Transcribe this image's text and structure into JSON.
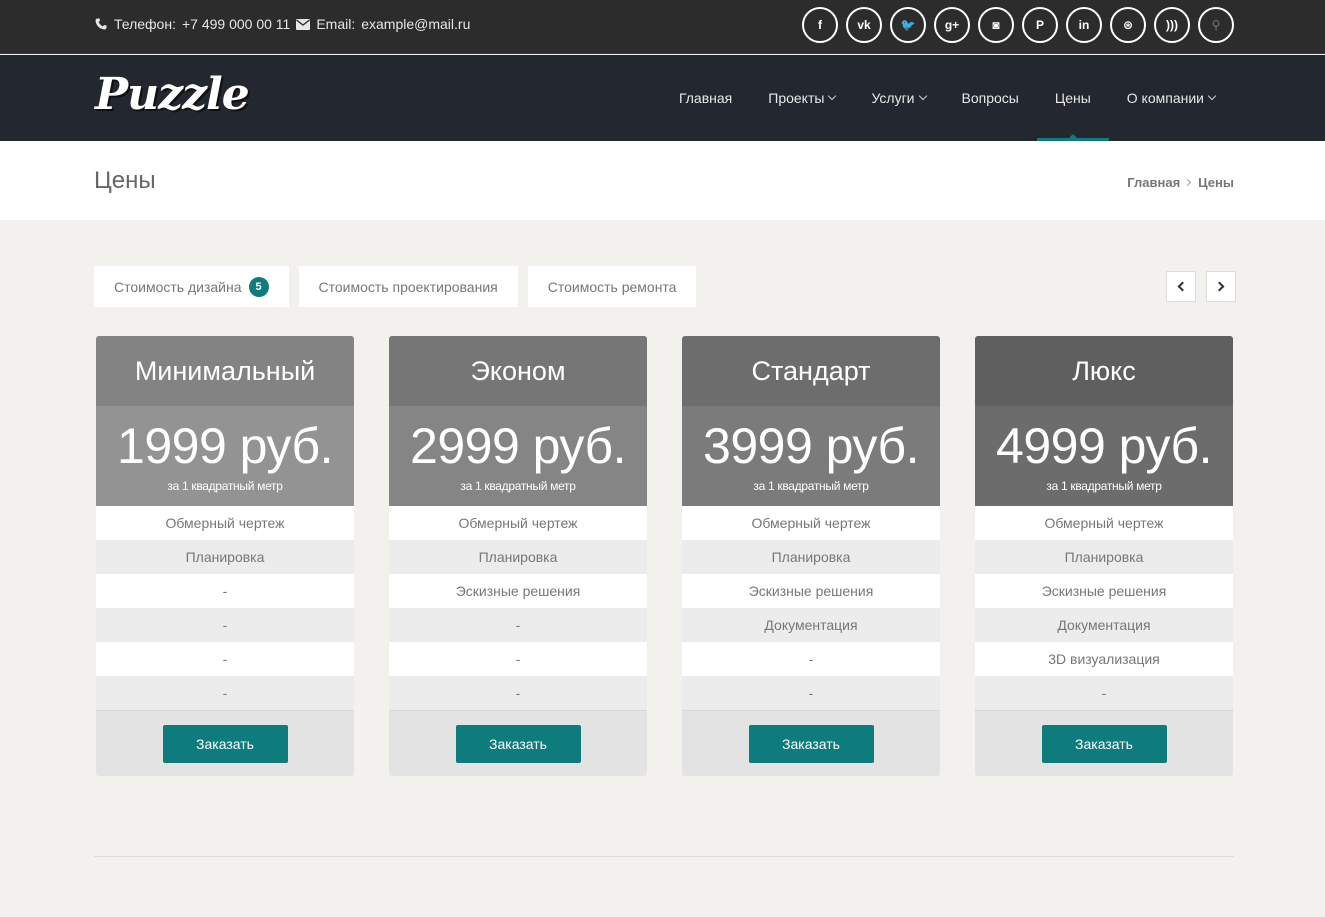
{
  "topbar": {
    "phone_label": "Телефон:",
    "phone": "+7 499 000 00 11",
    "email_label": "Email:",
    "email": "example@mail.ru",
    "socials": [
      {
        "name": "facebook-icon",
        "glyph": "f"
      },
      {
        "name": "vk-icon",
        "glyph": "vk"
      },
      {
        "name": "twitter-icon",
        "glyph": "🐦"
      },
      {
        "name": "google-plus-icon",
        "glyph": "g+"
      },
      {
        "name": "instagram-icon",
        "glyph": "◙"
      },
      {
        "name": "pinterest-icon",
        "glyph": "P"
      },
      {
        "name": "linkedin-icon",
        "glyph": "in"
      },
      {
        "name": "dribbble-icon",
        "glyph": "⊛"
      },
      {
        "name": "rss-icon",
        "glyph": ")))"
      },
      {
        "name": "search-icon",
        "glyph": "⚲"
      }
    ]
  },
  "header": {
    "logo": "Puzzle",
    "nav": [
      {
        "label": "Главная",
        "dropdown": false,
        "active": false
      },
      {
        "label": "Проекты",
        "dropdown": true,
        "active": false
      },
      {
        "label": "Услуги",
        "dropdown": true,
        "active": false
      },
      {
        "label": "Вопросы",
        "dropdown": false,
        "active": false
      },
      {
        "label": "Цены",
        "dropdown": false,
        "active": true
      },
      {
        "label": "О компании",
        "dropdown": true,
        "active": false
      }
    ]
  },
  "page": {
    "title": "Цены",
    "breadcrumb": [
      "Главная",
      "Цены"
    ]
  },
  "tabs": [
    {
      "label": "Стоимость дизайна",
      "badge": "5"
    },
    {
      "label": "Стоимость проектирования",
      "badge": ""
    },
    {
      "label": "Стоимость ремонта",
      "badge": ""
    }
  ],
  "plans": [
    {
      "name": "Минимальный",
      "price": "1999 руб.",
      "unit": "за 1 квадратный метр",
      "features": [
        "Обмерный чертеж",
        "Планировка",
        "-",
        "-",
        "-",
        "-"
      ],
      "button": "Заказать"
    },
    {
      "name": "Эконом",
      "price": "2999 руб.",
      "unit": "за 1 квадратный метр",
      "features": [
        "Обмерный чертеж",
        "Планировка",
        "Эскизные решения",
        "-",
        "-",
        "-"
      ],
      "button": "Заказать"
    },
    {
      "name": "Стандарт",
      "price": "3999 руб.",
      "unit": "за 1 квадратный метр",
      "features": [
        "Обмерный чертеж",
        "Планировка",
        "Эскизные решения",
        "Документация",
        "-",
        "-"
      ],
      "button": "Заказать"
    },
    {
      "name": "Люкс",
      "price": "4999 руб.",
      "unit": "за 1 квадратный метр",
      "features": [
        "Обмерный чертеж",
        "Планировка",
        "Эскизные решения",
        "Документация",
        "3D визуализация",
        "-"
      ],
      "button": "Заказать"
    }
  ],
  "colors": {
    "accent": "#0e7c7c",
    "topbar": "#2c2c2c",
    "header": "#232830",
    "page_bg": "#f2f1ee"
  }
}
